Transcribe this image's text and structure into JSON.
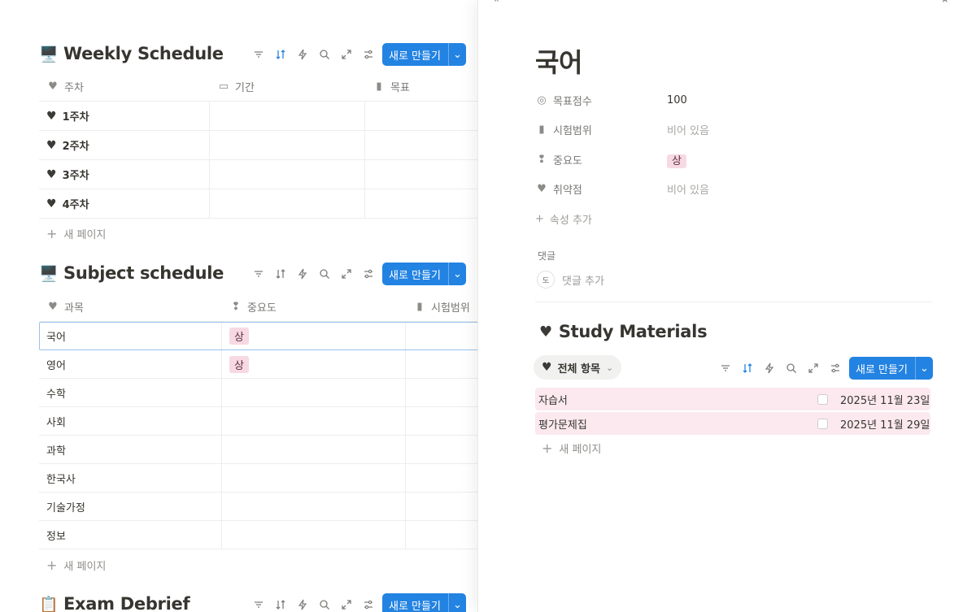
{
  "weekly": {
    "emoji": "🖥️",
    "title": "Weekly Schedule",
    "new_label": "새로 만들기",
    "columns": [
      "주차",
      "기간",
      "목표"
    ],
    "rows": [
      "1주차",
      "2주차",
      "3주차",
      "4주차"
    ],
    "new_page": "새 페이지"
  },
  "subject": {
    "emoji": "🖥️",
    "title": "Subject schedule",
    "new_label": "새로 만들기",
    "columns": [
      "과목",
      "중요도",
      "시험범위"
    ],
    "rows": [
      {
        "name": "국어",
        "importance": "상"
      },
      {
        "name": "영어",
        "importance": "상"
      },
      {
        "name": "수학",
        "importance": ""
      },
      {
        "name": "사회",
        "importance": ""
      },
      {
        "name": "과학",
        "importance": ""
      },
      {
        "name": "한국사",
        "importance": ""
      },
      {
        "name": "기술가정",
        "importance": ""
      },
      {
        "name": "정보",
        "importance": ""
      }
    ],
    "new_page": "새 페이지"
  },
  "exam": {
    "emoji": "📋",
    "title": "Exam Debrief",
    "new_label": "새로 만들기"
  },
  "detail": {
    "title": "국어",
    "props": [
      {
        "name": "목표점수",
        "value": "100"
      },
      {
        "name": "시험범위",
        "value": "비어 있음"
      },
      {
        "name": "중요도",
        "value": "상"
      },
      {
        "name": "취약점",
        "value": "비어 있음"
      }
    ],
    "add_prop": "속성 추가",
    "comments_label": "댓글",
    "avatar": "도",
    "add_comment": "댓글 추가",
    "materials": {
      "title": "Study Materials",
      "view": "전체 항목",
      "new_label": "새로 만들기",
      "rows": [
        {
          "name": "자습서",
          "date": "2025년 11월 23일"
        },
        {
          "name": "평가문제집",
          "date": "2025년 11월 29일"
        }
      ],
      "new_page": "새 페이지"
    }
  },
  "colors": {
    "accent": "#2383e2",
    "tag_bg": "#f7d9e3",
    "row_bg": "#fbe9ef"
  }
}
